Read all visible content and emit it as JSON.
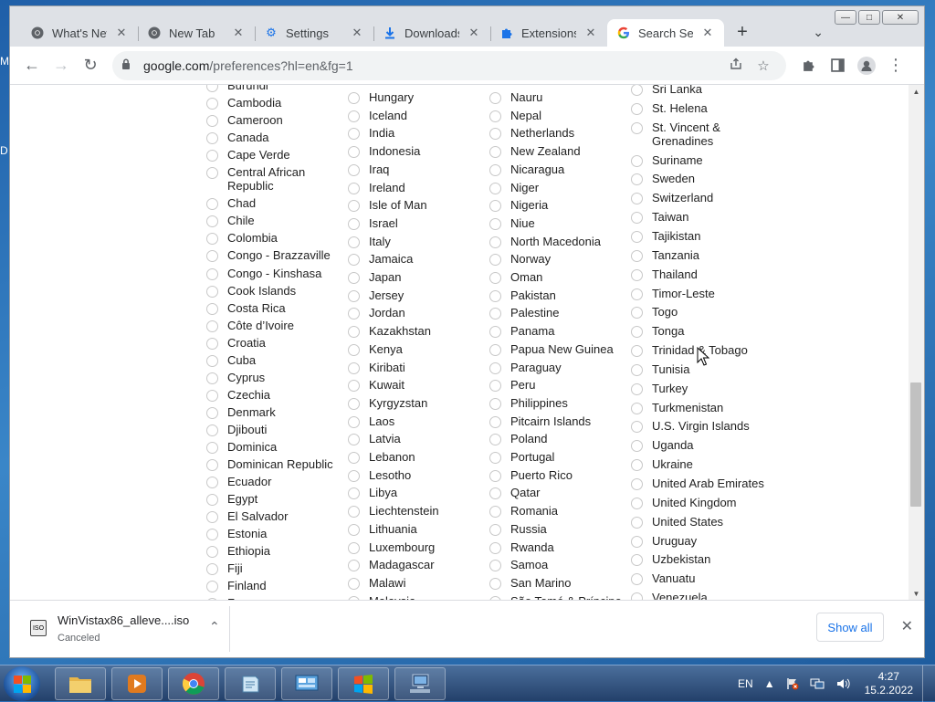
{
  "desktop": {
    "edge_labels": [
      "M",
      "D"
    ]
  },
  "window": {
    "controls": {
      "minimize": "—",
      "maximize": "□",
      "close": "✕"
    }
  },
  "tabs": [
    {
      "title": "What's New",
      "icon": "chrome-icon",
      "close": "✕"
    },
    {
      "title": "New Tab",
      "icon": "chrome-icon",
      "close": "✕"
    },
    {
      "title": "Settings",
      "icon": "gear-icon",
      "close": "✕"
    },
    {
      "title": "Downloads",
      "icon": "download-icon",
      "close": "✕"
    },
    {
      "title": "Extensions",
      "icon": "puzzle-icon",
      "close": "✕"
    },
    {
      "title": "Search Setti",
      "icon": "google-icon",
      "close": "✕",
      "active": true
    }
  ],
  "tabstrip": {
    "new_tab": "+",
    "tab_search": "⌄"
  },
  "toolbar": {
    "back": "←",
    "forward": "→",
    "reload": "↻",
    "url_host": "google.com",
    "url_path": "/preferences?hl=en&fg=1",
    "share_icon": "share-icon",
    "bookmark_icon": "star-icon",
    "extensions_icon": "puzzle-icon",
    "sidepanel_icon": "side-panel-icon",
    "profile_icon": "avatar-icon",
    "menu_icon": "kebab-menu-icon"
  },
  "regions": {
    "col1": [
      "Burundi",
      "Cambodia",
      "Cameroon",
      "Canada",
      "Cape Verde",
      "Central African Republic",
      "Chad",
      "Chile",
      "Colombia",
      "Congo - Brazzaville",
      "Congo - Kinshasa",
      "Cook Islands",
      "Costa Rica",
      "Côte d’Ivoire",
      "Croatia",
      "Cuba",
      "Cyprus",
      "Czechia",
      "Denmark",
      "Djibouti",
      "Dominica",
      "Dominican Republic",
      "Ecuador",
      "Egypt",
      "El Salvador",
      "Estonia",
      "Ethiopia",
      "Fiji",
      "Finland",
      "France"
    ],
    "col2": [
      "Hungary",
      "Iceland",
      "India",
      "Indonesia",
      "Iraq",
      "Ireland",
      "Isle of Man",
      "Israel",
      "Italy",
      "Jamaica",
      "Japan",
      "Jersey",
      "Jordan",
      "Kazakhstan",
      "Kenya",
      "Kiribati",
      "Kuwait",
      "Kyrgyzstan",
      "Laos",
      "Latvia",
      "Lebanon",
      "Lesotho",
      "Libya",
      "Liechtenstein",
      "Lithuania",
      "Luxembourg",
      "Madagascar",
      "Malawi",
      "Malaysia"
    ],
    "col3": [
      "Nauru",
      "Nepal",
      "Netherlands",
      "New Zealand",
      "Nicaragua",
      "Niger",
      "Nigeria",
      "Niue",
      "North Macedonia",
      "Norway",
      "Oman",
      "Pakistan",
      "Palestine",
      "Panama",
      "Papua New Guinea",
      "Paraguay",
      "Peru",
      "Philippines",
      "Pitcairn Islands",
      "Poland",
      "Portugal",
      "Puerto Rico",
      "Qatar",
      "Romania",
      "Russia",
      "Rwanda",
      "Samoa",
      "San Marino",
      "São Tomé & Príncipe"
    ],
    "col4": [
      "Sri Lanka",
      "St. Helena",
      "St. Vincent & Grenadines",
      "Suriname",
      "Sweden",
      "Switzerland",
      "Taiwan",
      "Tajikistan",
      "Tanzania",
      "Thailand",
      "Timor-Leste",
      "Togo",
      "Tonga",
      "Trinidad & Tobago",
      "Tunisia",
      "Turkey",
      "Turkmenistan",
      "U.S. Virgin Islands",
      "Uganda",
      "Ukraine",
      "United Arab Emirates",
      "United Kingdom",
      "United States",
      "Uruguay",
      "Uzbekistan",
      "Vanuatu",
      "Venezuela"
    ]
  },
  "scrollbar": {
    "up": "▲",
    "down": "▼",
    "position": 0.58
  },
  "download_shelf": {
    "file_name": "WinVistax86_alleve....iso",
    "status": "Canceled",
    "icon": "iso-file-icon",
    "icon_text": "ISO",
    "chevron": "⌃",
    "show_all": "Show all",
    "close": "✕"
  },
  "taskbar": {
    "apps": [
      {
        "name": "explorer-icon"
      },
      {
        "name": "media-player-icon"
      },
      {
        "name": "chrome-icon"
      },
      {
        "name": "notepad-icon"
      },
      {
        "name": "control-panel-icon"
      },
      {
        "name": "windows-update-icon"
      },
      {
        "name": "network-computer-icon"
      }
    ],
    "tray": {
      "language": "EN",
      "time": "4:27",
      "date": "15.2.2022"
    }
  },
  "colors": {
    "accent": "#1a73e8",
    "tab_bg": "#dee1e6",
    "taskbar": "#23406a"
  }
}
